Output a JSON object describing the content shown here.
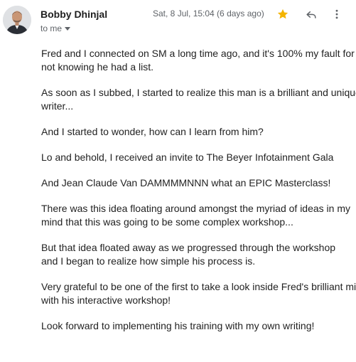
{
  "header": {
    "sender_name": "Bobby Dhinjal",
    "recipient_label": "to me",
    "date_label": "Sat, 8 Jul, 15:04 (6 days ago)",
    "starred": true,
    "icons": {
      "star": "star-icon",
      "reply": "reply-icon",
      "more": "more-vert-icon",
      "recipient_toggle": "chevron-down-icon"
    },
    "colors": {
      "star": "#f4b400",
      "icon": "#5f6368"
    }
  },
  "body": {
    "paragraphs": [
      [
        "Fred and I connected on SM a long time ago, and it's 100% my fault for",
        "not knowing he had a list."
      ],
      [
        "As soon as I subbed, I started to realize this man is a brilliant and unique",
        "writer..."
      ],
      [
        "And I started to wonder, how can I learn from him?"
      ],
      [
        "Lo and behold, I received an invite to The Beyer Infotainment Gala"
      ],
      [
        "And Jean Claude Van DAMMMMNNN what an EPIC Masterclass!"
      ],
      [
        "There was this idea floating around amongst the myriad of ideas in my",
        "mind that this was going to be some complex workshop..."
      ],
      [
        "But that idea floated away as we progressed through the workshop",
        "and I began to realize how simple his process is."
      ],
      [
        "Very grateful to be one of the first to take a look inside Fred's brilliant mind",
        "with his interactive workshop!"
      ],
      [
        "Look forward to implementing his training with my own writing!"
      ]
    ]
  }
}
